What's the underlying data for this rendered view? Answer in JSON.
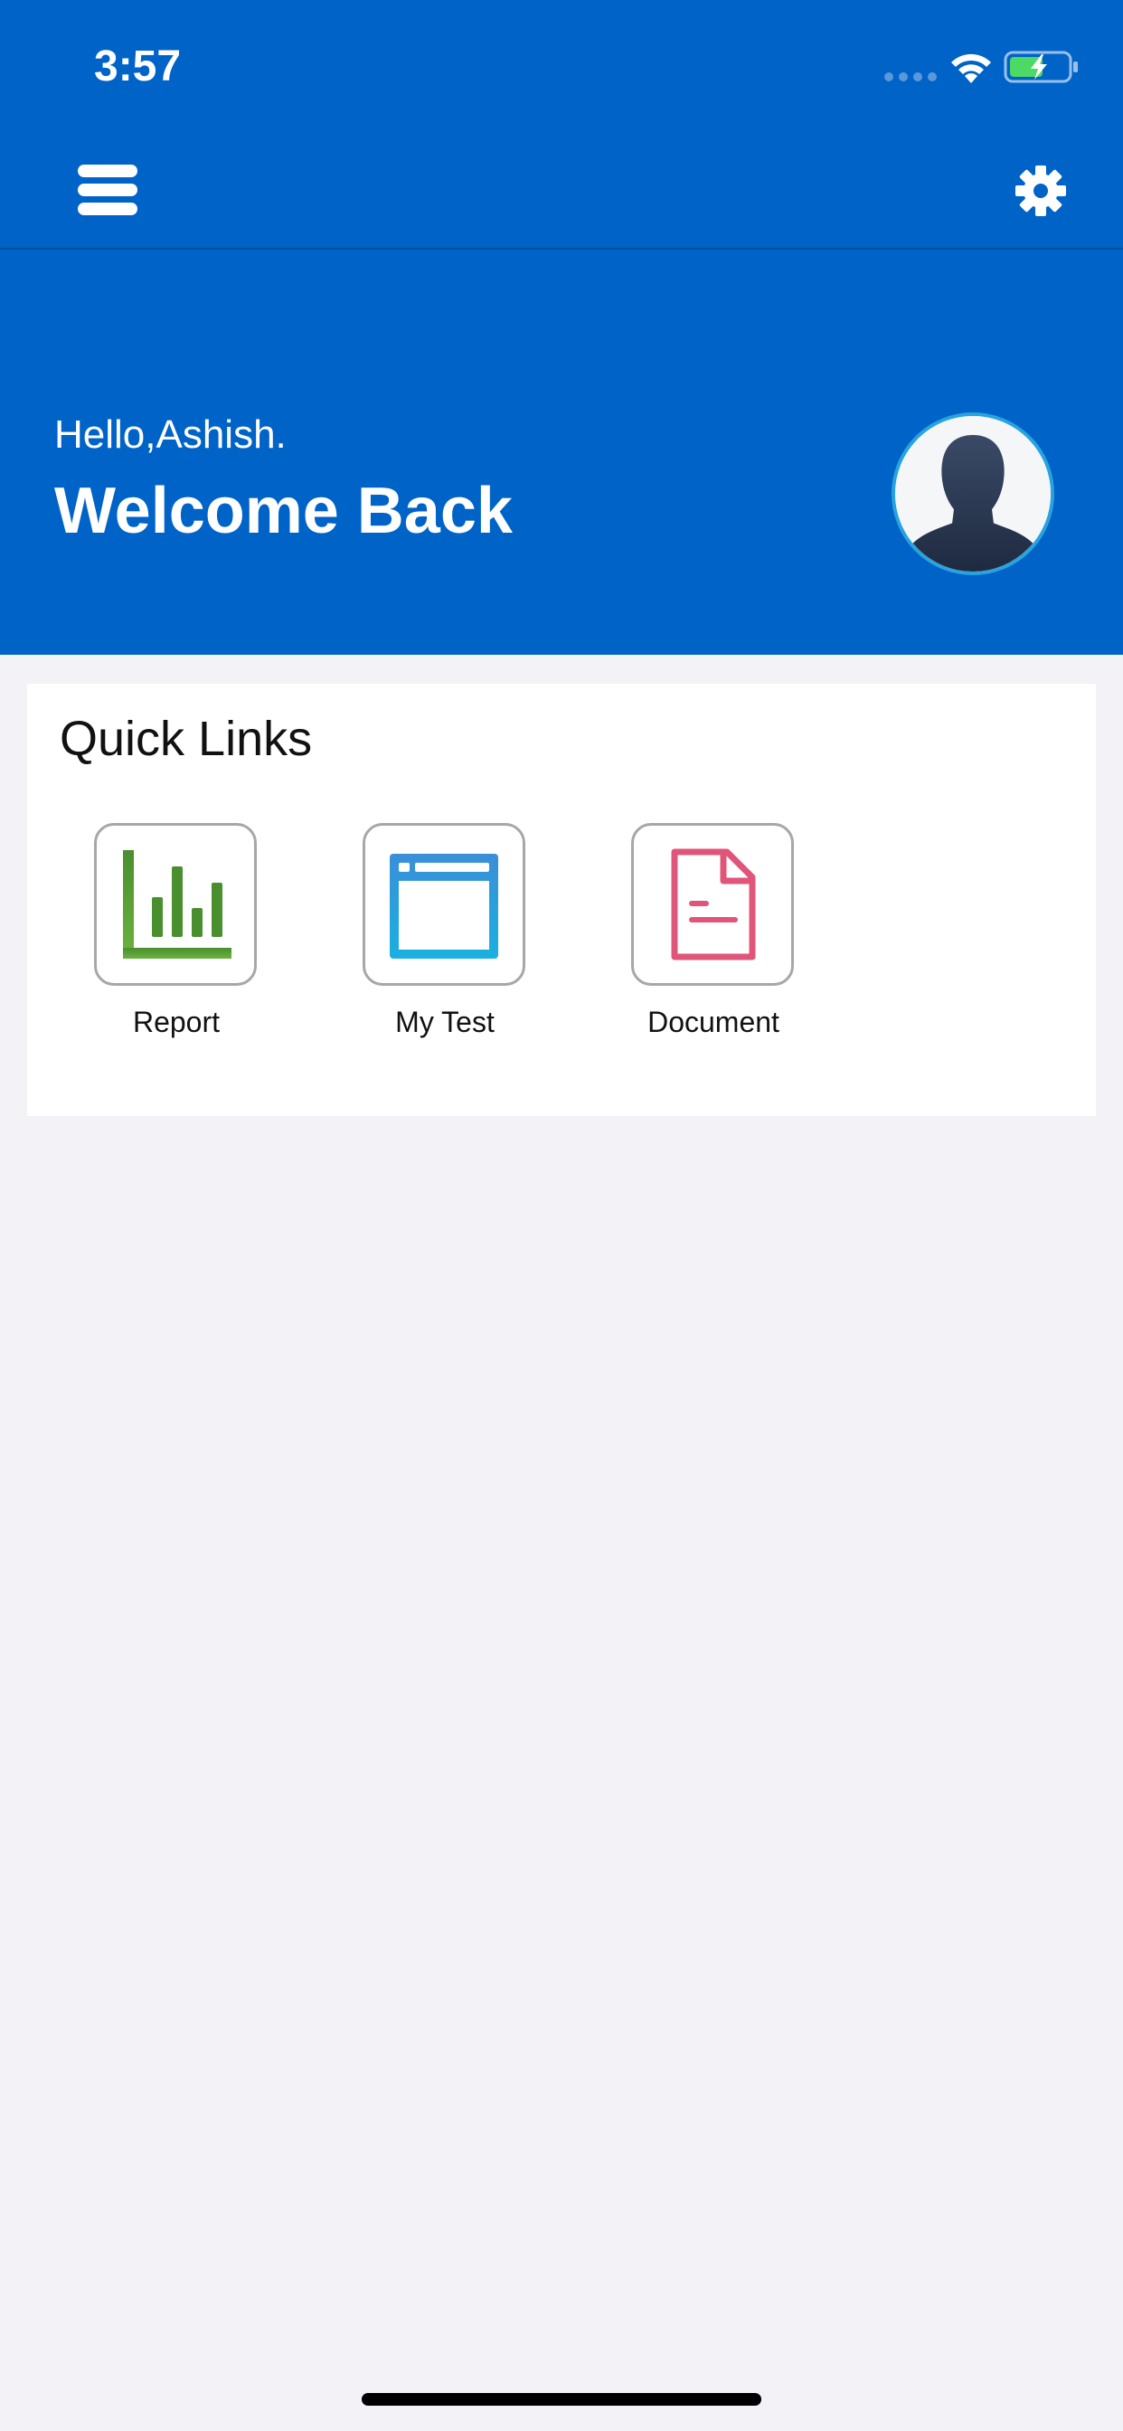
{
  "status_bar": {
    "time": "3:57"
  },
  "nav_bar": {
    "menu_icon": "hamburger-menu-icon",
    "settings_icon": "gear-icon"
  },
  "header": {
    "greeting": "Hello,Ashish.",
    "welcome": "Welcome Back",
    "avatar_icon": "user-silhouette-icon"
  },
  "quick_links": {
    "title": "Quick Links",
    "items": [
      {
        "label": "Report",
        "icon": "bar-chart-icon",
        "color": "#4a8f2e"
      },
      {
        "label": "My Test",
        "icon": "browser-window-icon",
        "color": "#2a8fd4"
      },
      {
        "label": "Document",
        "icon": "document-icon",
        "color": "#e0567a"
      }
    ]
  },
  "colors": {
    "primary": "#0063c7",
    "background": "#f2f2f7",
    "card": "#ffffff",
    "avatar_ring": "#29a3e0",
    "battery_fill": "#4cd964"
  }
}
